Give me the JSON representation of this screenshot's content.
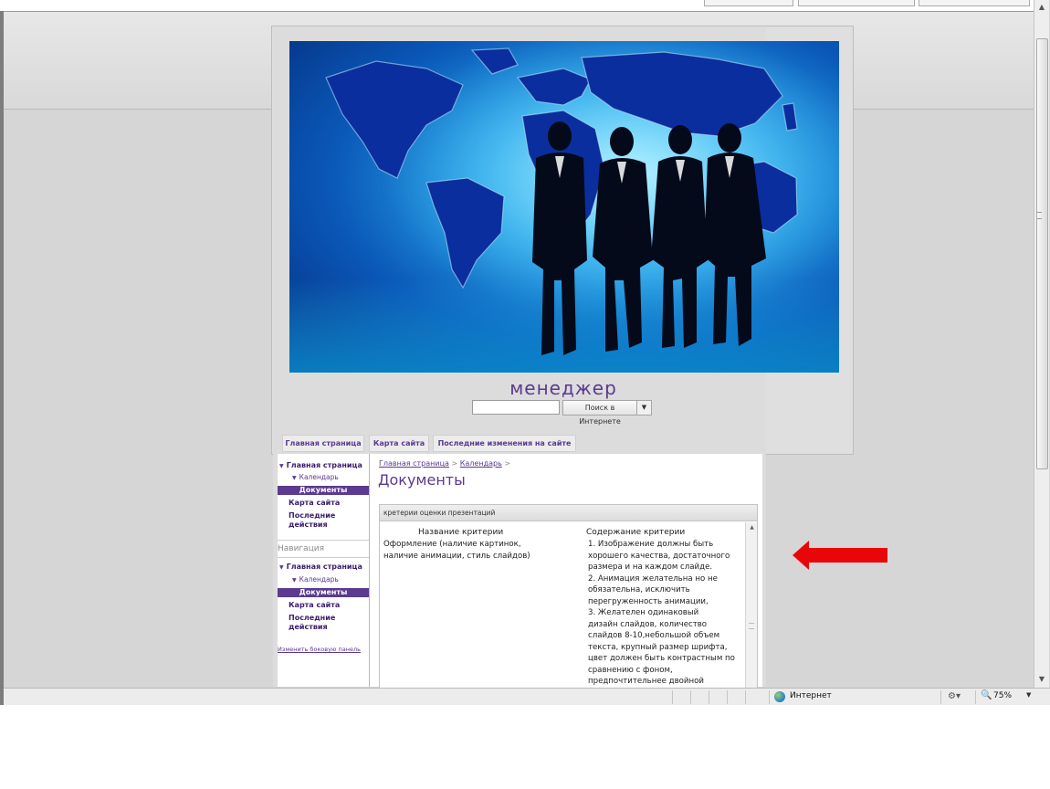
{
  "site": {
    "title": "менеджер",
    "search": {
      "value": "",
      "button_label": "Поиск в Интернете"
    }
  },
  "topnav": {
    "tabs": [
      {
        "label": "Главная страница"
      },
      {
        "label": "Карта сайта"
      },
      {
        "label": "Последние изменения на сайте"
      }
    ]
  },
  "leftnav": {
    "home": "Главная страница",
    "calendar": "Календарь",
    "documents": "Документы",
    "sitemap": "Карта сайта",
    "recent": "Последние действия",
    "nav_heading": "Навигация",
    "edit_sidebar": "Изменить боковую панель"
  },
  "breadcrumb": {
    "home": "Главная страница",
    "sep": ">",
    "calendar": "Календарь"
  },
  "page": {
    "title": "Документы"
  },
  "panel": {
    "title": "кретерии оценки презентаций",
    "col1_header": "Название критерии",
    "col2_header": "Содержание критерии",
    "col1_text": [
      "Оформление (наличие картинок,",
      "наличие анимации, стиль слайдов)"
    ],
    "col2_text": [
      "1.    Изображение должны быть",
      "хорошего качества, достаточного",
      "размера и на каждом слайде.",
      "2.   Анимация желательна но не",
      "обязательна, исключить",
      "перегруженность анимации,",
      "3.    Желателен одинаковый",
      "дизайн слайдов, количество",
      "слайдов 8-10,небольшой объем",
      "текста, крупный размер шрифта,",
      "цвет должен быть контрастным по",
      "сравнению с фоном,",
      "предпочтительнее двойной"
    ]
  },
  "statusbar": {
    "zone": "Интернет",
    "zoom": "75%"
  },
  "colors": {
    "accent": "#5b3a8f",
    "annotation_arrow": "#e8060a"
  },
  "icons": [
    "globe-icon",
    "security-icon",
    "zoom-icon",
    "chevron-down-icon",
    "arrow-left-icon"
  ]
}
